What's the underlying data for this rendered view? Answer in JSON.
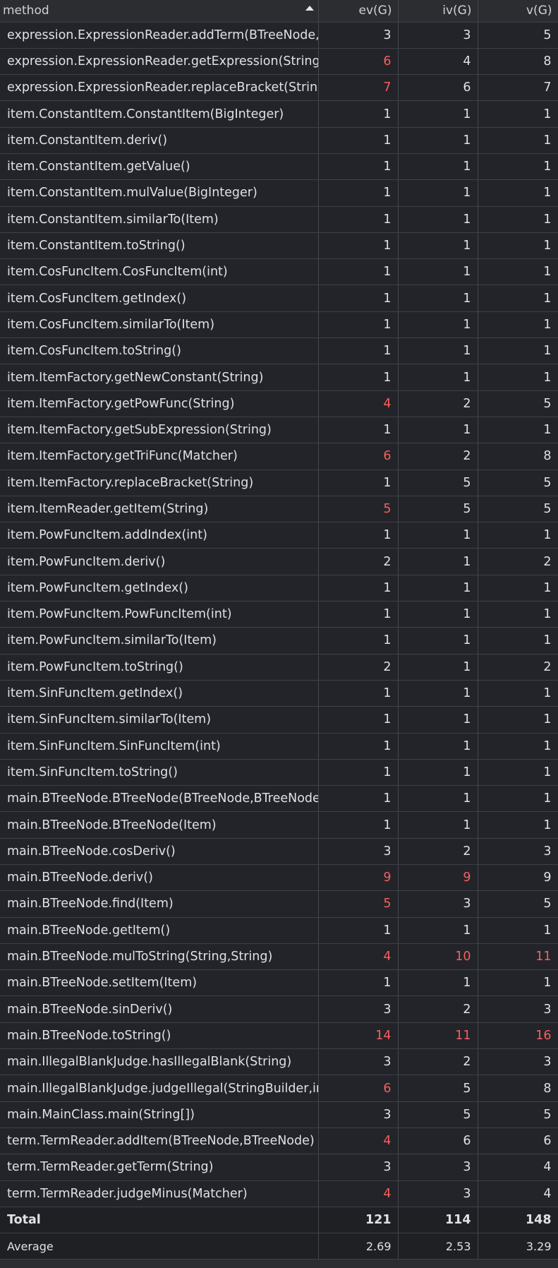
{
  "header": {
    "method": "method",
    "ev": "ev(G)",
    "iv": "iv(G)",
    "v": "v(G)"
  },
  "rows": [
    {
      "method": "expression.ExpressionReader.addTerm(BTreeNode,BTreeNode)",
      "ev": "3",
      "iv": "3",
      "v": "5",
      "ev_red": false,
      "iv_red": false,
      "v_red": false
    },
    {
      "method": "expression.ExpressionReader.getExpression(String)",
      "ev": "6",
      "iv": "4",
      "v": "8",
      "ev_red": true,
      "iv_red": false,
      "v_red": false
    },
    {
      "method": "expression.ExpressionReader.replaceBracket(String)",
      "ev": "7",
      "iv": "6",
      "v": "7",
      "ev_red": true,
      "iv_red": false,
      "v_red": false
    },
    {
      "method": "item.ConstantItem.ConstantItem(BigInteger)",
      "ev": "1",
      "iv": "1",
      "v": "1",
      "ev_red": false,
      "iv_red": false,
      "v_red": false
    },
    {
      "method": "item.ConstantItem.deriv()",
      "ev": "1",
      "iv": "1",
      "v": "1",
      "ev_red": false,
      "iv_red": false,
      "v_red": false
    },
    {
      "method": "item.ConstantItem.getValue()",
      "ev": "1",
      "iv": "1",
      "v": "1",
      "ev_red": false,
      "iv_red": false,
      "v_red": false
    },
    {
      "method": "item.ConstantItem.mulValue(BigInteger)",
      "ev": "1",
      "iv": "1",
      "v": "1",
      "ev_red": false,
      "iv_red": false,
      "v_red": false
    },
    {
      "method": "item.ConstantItem.similarTo(Item)",
      "ev": "1",
      "iv": "1",
      "v": "1",
      "ev_red": false,
      "iv_red": false,
      "v_red": false
    },
    {
      "method": "item.ConstantItem.toString()",
      "ev": "1",
      "iv": "1",
      "v": "1",
      "ev_red": false,
      "iv_red": false,
      "v_red": false
    },
    {
      "method": "item.CosFuncItem.CosFuncItem(int)",
      "ev": "1",
      "iv": "1",
      "v": "1",
      "ev_red": false,
      "iv_red": false,
      "v_red": false
    },
    {
      "method": "item.CosFuncItem.getIndex()",
      "ev": "1",
      "iv": "1",
      "v": "1",
      "ev_red": false,
      "iv_red": false,
      "v_red": false
    },
    {
      "method": "item.CosFuncItem.similarTo(Item)",
      "ev": "1",
      "iv": "1",
      "v": "1",
      "ev_red": false,
      "iv_red": false,
      "v_red": false
    },
    {
      "method": "item.CosFuncItem.toString()",
      "ev": "1",
      "iv": "1",
      "v": "1",
      "ev_red": false,
      "iv_red": false,
      "v_red": false
    },
    {
      "method": "item.ItemFactory.getNewConstant(String)",
      "ev": "1",
      "iv": "1",
      "v": "1",
      "ev_red": false,
      "iv_red": false,
      "v_red": false
    },
    {
      "method": "item.ItemFactory.getPowFunc(String)",
      "ev": "4",
      "iv": "2",
      "v": "5",
      "ev_red": true,
      "iv_red": false,
      "v_red": false
    },
    {
      "method": "item.ItemFactory.getSubExpression(String)",
      "ev": "1",
      "iv": "1",
      "v": "1",
      "ev_red": false,
      "iv_red": false,
      "v_red": false
    },
    {
      "method": "item.ItemFactory.getTriFunc(Matcher)",
      "ev": "6",
      "iv": "2",
      "v": "8",
      "ev_red": true,
      "iv_red": false,
      "v_red": false
    },
    {
      "method": "item.ItemFactory.replaceBracket(String)",
      "ev": "1",
      "iv": "5",
      "v": "5",
      "ev_red": false,
      "iv_red": false,
      "v_red": false
    },
    {
      "method": "item.ItemReader.getItem(String)",
      "ev": "5",
      "iv": "5",
      "v": "5",
      "ev_red": true,
      "iv_red": false,
      "v_red": false
    },
    {
      "method": "item.PowFuncItem.addIndex(int)",
      "ev": "1",
      "iv": "1",
      "v": "1",
      "ev_red": false,
      "iv_red": false,
      "v_red": false
    },
    {
      "method": "item.PowFuncItem.deriv()",
      "ev": "2",
      "iv": "1",
      "v": "2",
      "ev_red": false,
      "iv_red": false,
      "v_red": false
    },
    {
      "method": "item.PowFuncItem.getIndex()",
      "ev": "1",
      "iv": "1",
      "v": "1",
      "ev_red": false,
      "iv_red": false,
      "v_red": false
    },
    {
      "method": "item.PowFuncItem.PowFuncItem(int)",
      "ev": "1",
      "iv": "1",
      "v": "1",
      "ev_red": false,
      "iv_red": false,
      "v_red": false
    },
    {
      "method": "item.PowFuncItem.similarTo(Item)",
      "ev": "1",
      "iv": "1",
      "v": "1",
      "ev_red": false,
      "iv_red": false,
      "v_red": false
    },
    {
      "method": "item.PowFuncItem.toString()",
      "ev": "2",
      "iv": "1",
      "v": "2",
      "ev_red": false,
      "iv_red": false,
      "v_red": false
    },
    {
      "method": "item.SinFuncItem.getIndex()",
      "ev": "1",
      "iv": "1",
      "v": "1",
      "ev_red": false,
      "iv_red": false,
      "v_red": false
    },
    {
      "method": "item.SinFuncItem.similarTo(Item)",
      "ev": "1",
      "iv": "1",
      "v": "1",
      "ev_red": false,
      "iv_red": false,
      "v_red": false
    },
    {
      "method": "item.SinFuncItem.SinFuncItem(int)",
      "ev": "1",
      "iv": "1",
      "v": "1",
      "ev_red": false,
      "iv_red": false,
      "v_red": false
    },
    {
      "method": "item.SinFuncItem.toString()",
      "ev": "1",
      "iv": "1",
      "v": "1",
      "ev_red": false,
      "iv_red": false,
      "v_red": false
    },
    {
      "method": "main.BTreeNode.BTreeNode(BTreeNode,BTreeNode)",
      "ev": "1",
      "iv": "1",
      "v": "1",
      "ev_red": false,
      "iv_red": false,
      "v_red": false
    },
    {
      "method": "main.BTreeNode.BTreeNode(Item)",
      "ev": "1",
      "iv": "1",
      "v": "1",
      "ev_red": false,
      "iv_red": false,
      "v_red": false
    },
    {
      "method": "main.BTreeNode.cosDeriv()",
      "ev": "3",
      "iv": "2",
      "v": "3",
      "ev_red": false,
      "iv_red": false,
      "v_red": false
    },
    {
      "method": "main.BTreeNode.deriv()",
      "ev": "9",
      "iv": "9",
      "v": "9",
      "ev_red": true,
      "iv_red": true,
      "v_red": false
    },
    {
      "method": "main.BTreeNode.find(Item)",
      "ev": "5",
      "iv": "3",
      "v": "5",
      "ev_red": true,
      "iv_red": false,
      "v_red": false
    },
    {
      "method": "main.BTreeNode.getItem()",
      "ev": "1",
      "iv": "1",
      "v": "1",
      "ev_red": false,
      "iv_red": false,
      "v_red": false
    },
    {
      "method": "main.BTreeNode.mulToString(String,String)",
      "ev": "4",
      "iv": "10",
      "v": "11",
      "ev_red": true,
      "iv_red": true,
      "v_red": true
    },
    {
      "method": "main.BTreeNode.setItem(Item)",
      "ev": "1",
      "iv": "1",
      "v": "1",
      "ev_red": false,
      "iv_red": false,
      "v_red": false
    },
    {
      "method": "main.BTreeNode.sinDeriv()",
      "ev": "3",
      "iv": "2",
      "v": "3",
      "ev_red": false,
      "iv_red": false,
      "v_red": false
    },
    {
      "method": "main.BTreeNode.toString()",
      "ev": "14",
      "iv": "11",
      "v": "16",
      "ev_red": true,
      "iv_red": true,
      "v_red": true
    },
    {
      "method": "main.IllegalBlankJudge.hasIllegalBlank(String)",
      "ev": "3",
      "iv": "2",
      "v": "3",
      "ev_red": false,
      "iv_red": false,
      "v_red": false
    },
    {
      "method": "main.IllegalBlankJudge.judgeIllegal(StringBuilder,int)",
      "ev": "6",
      "iv": "5",
      "v": "8",
      "ev_red": true,
      "iv_red": false,
      "v_red": false
    },
    {
      "method": "main.MainClass.main(String[])",
      "ev": "3",
      "iv": "5",
      "v": "5",
      "ev_red": false,
      "iv_red": false,
      "v_red": false
    },
    {
      "method": "term.TermReader.addItem(BTreeNode,BTreeNode)",
      "ev": "4",
      "iv": "6",
      "v": "6",
      "ev_red": true,
      "iv_red": false,
      "v_red": false
    },
    {
      "method": "term.TermReader.getTerm(String)",
      "ev": "3",
      "iv": "3",
      "v": "4",
      "ev_red": false,
      "iv_red": false,
      "v_red": false
    },
    {
      "method": "term.TermReader.judgeMinus(Matcher)",
      "ev": "4",
      "iv": "3",
      "v": "4",
      "ev_red": true,
      "iv_red": false,
      "v_red": false
    }
  ],
  "total": {
    "label": "Total",
    "ev": "121",
    "iv": "114",
    "v": "148"
  },
  "average": {
    "label": "Average",
    "ev": "2.69",
    "iv": "2.53",
    "v": "3.29"
  },
  "colors": {
    "background": "#222429",
    "text": "#dfe1e5",
    "warning": "#f75f5f",
    "grid": "#3e4146"
  }
}
